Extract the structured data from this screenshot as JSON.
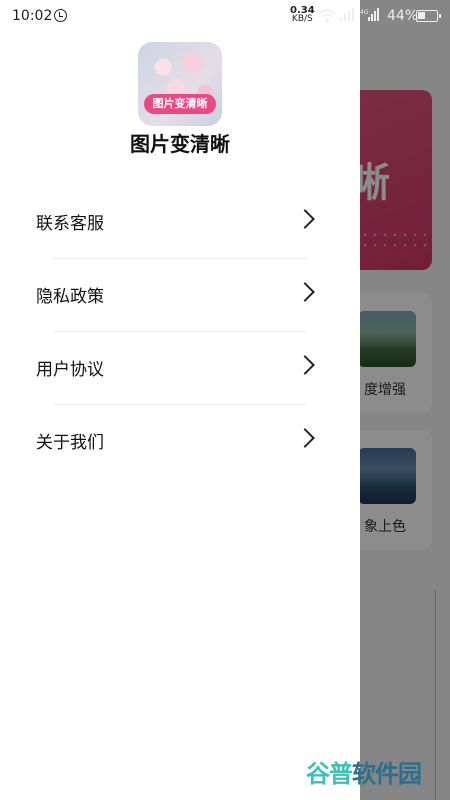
{
  "status_bar": {
    "time": "10:02",
    "net_speed_value": "0.34",
    "net_speed_unit": "KB/S",
    "network_type": "4G",
    "battery": "44%"
  },
  "background_screen": {
    "banner_text": "晰",
    "cards": [
      {
        "label": "度增强"
      },
      {
        "label": "象上色"
      }
    ]
  },
  "drawer": {
    "logo_badge": "图片变清晰",
    "app_name": "图片变清晰",
    "menu": [
      {
        "label": "联系客服"
      },
      {
        "label": "隐私政策"
      },
      {
        "label": "用户协议"
      },
      {
        "label": "关于我们"
      }
    ]
  },
  "watermark": {
    "text_left": "谷普",
    "text_right": "软件园"
  },
  "colors": {
    "accent_pink": "#e94a84",
    "watermark_teal": "#3cc0b8"
  }
}
